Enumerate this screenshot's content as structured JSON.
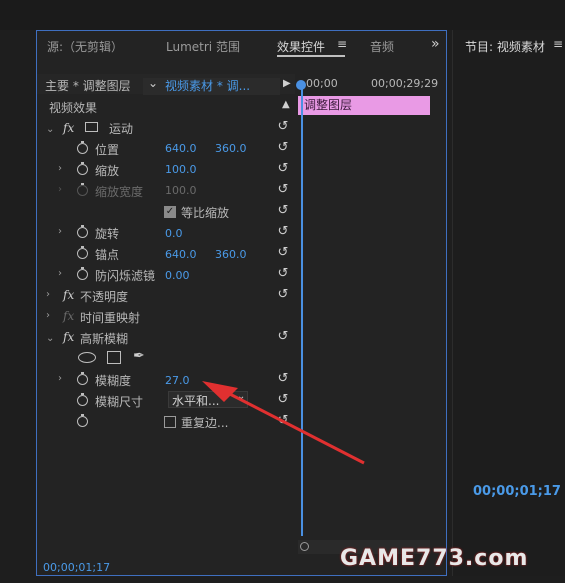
{
  "tabs": {
    "source": "源:（无剪辑）",
    "lumetri": "Lumetri 范围",
    "effect_controls": "效果控件",
    "effect_menu": "≡",
    "audio": "音频",
    "more": "»",
    "program": "节目: 视频素材"
  },
  "header": {
    "master": "主要 * 调整图层",
    "clip": "视频素材 * 调..."
  },
  "timeline": {
    "start_tc": "00;00",
    "end_tc": "00;00;29;29",
    "clip_label": "调整图层"
  },
  "section": {
    "video_effects": "视频效果"
  },
  "effects": {
    "motion": "运动",
    "position": "位置",
    "position_x": "640.0",
    "position_y": "360.0",
    "scale": "缩放",
    "scale_val": "100.0",
    "scale_width": "缩放宽度",
    "scale_width_val": "100.0",
    "uniform_scale": "等比缩放",
    "rotation": "旋转",
    "rotation_val": "0.0",
    "anchor": "锚点",
    "anchor_x": "640.0",
    "anchor_y": "360.0",
    "flicker": "防闪烁滤镜",
    "flicker_val": "0.00",
    "opacity": "不透明度",
    "time_remap": "时间重映射",
    "gaussian_blur": "高斯模糊",
    "blurriness": "模糊度",
    "blurriness_val": "27.0",
    "blur_dim": "模糊尺寸",
    "blur_dim_val": "水平和...",
    "repeat_edge": "重复边..."
  },
  "footer": {
    "timecode": "00;00;01;17",
    "program_tc": "00;00;01;17"
  },
  "watermark": "GAME773.com",
  "colors": {
    "accent_blue": "#4a9ae8",
    "clip_pink": "#e99ae5",
    "arrow_red": "#e03030"
  }
}
